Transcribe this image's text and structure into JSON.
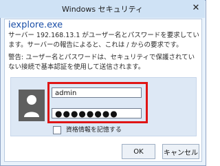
{
  "window": {
    "title": "Windows セキュリティ",
    "close_icon": "close-icon"
  },
  "dialog": {
    "app_name": "iexplore.exe",
    "message": "サーバー 192.168.13.1 がユーザー名とパスワードを要求しています。サーバーの報告によると、これは / からの要求です。",
    "warning": "警告: ユーザー名とパスワードは、セキュリティで保護されていない接続で基本認証を使用して送信されます。"
  },
  "credentials": {
    "username": "admin",
    "password_mask": "●●●●●●●●",
    "remember_label": "資格情報を記憶する",
    "remember_checked": false,
    "avatar_icon": "user-avatar-icon"
  },
  "buttons": {
    "ok": "OK",
    "cancel": "キャンセル"
  }
}
